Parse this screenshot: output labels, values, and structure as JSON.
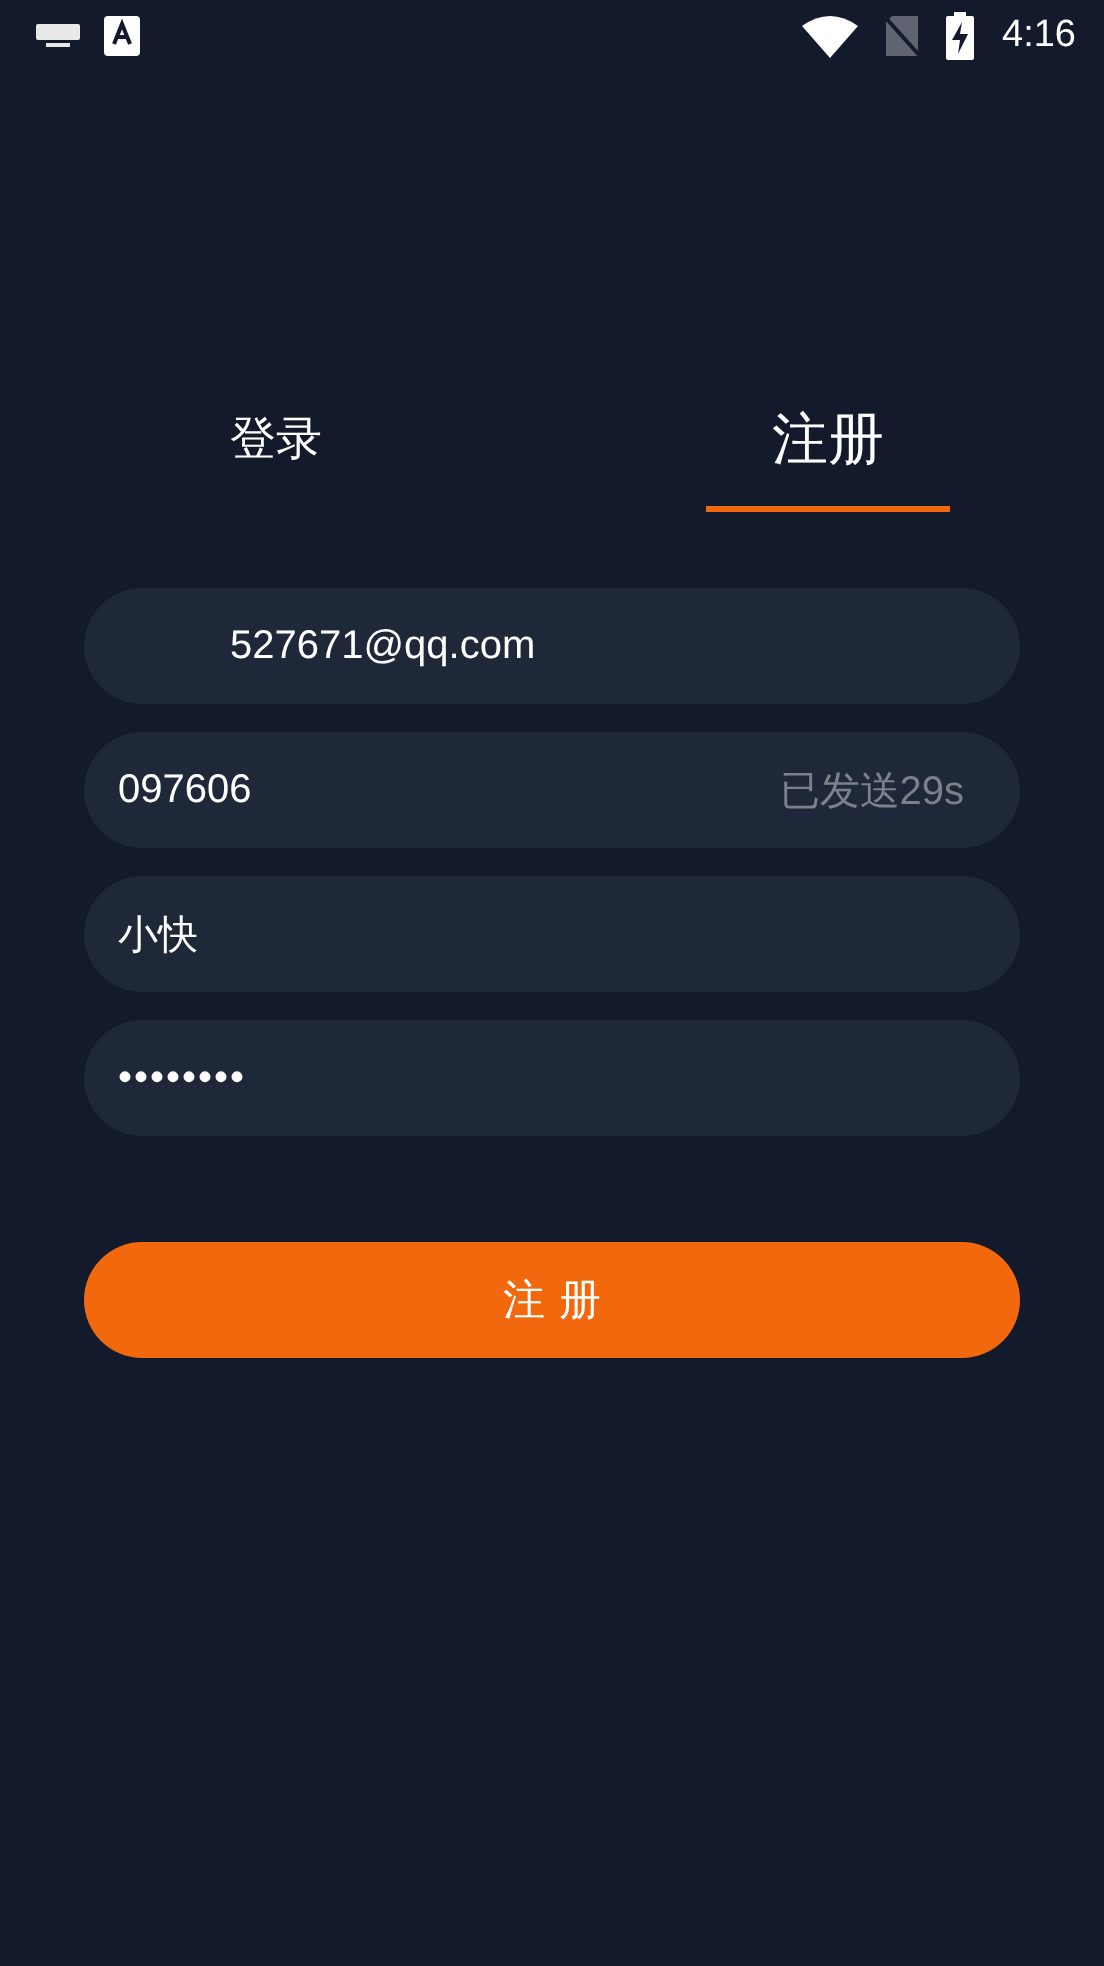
{
  "status_bar": {
    "time": "4:16"
  },
  "tabs": [
    {
      "label": "登录",
      "selected": false
    },
    {
      "label": "注册",
      "selected": true
    }
  ],
  "fields": [
    {
      "kind": "email",
      "value": "527671@qq.com"
    },
    {
      "kind": "code",
      "value": "097606",
      "status": "已发送29s"
    },
    {
      "kind": "text",
      "value": "小快"
    },
    {
      "kind": "password",
      "value": "••••••••"
    }
  ],
  "submit_button": {
    "label": "注 册"
  }
}
